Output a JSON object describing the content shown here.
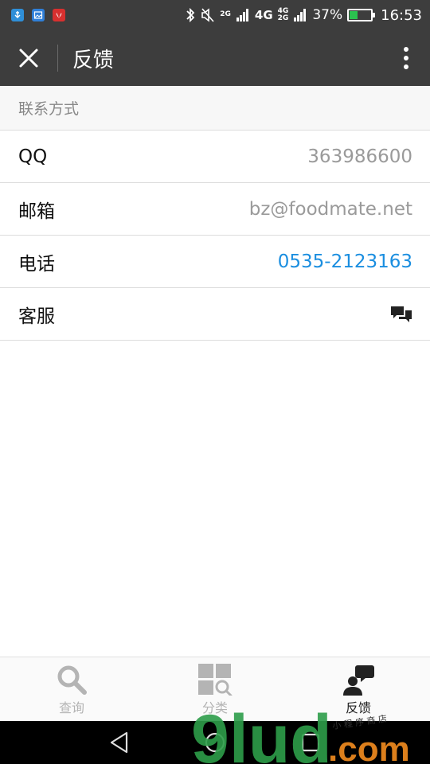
{
  "status_bar": {
    "net_2g": "2G",
    "net_4g": "4G",
    "net_4g_small": "4G",
    "net_2g_small": "2G",
    "battery_pct": "37%",
    "battery_level": 0.37,
    "time": "16:53"
  },
  "header": {
    "title": "反馈"
  },
  "section": {
    "title": "联系方式"
  },
  "rows": [
    {
      "label": "QQ",
      "value": "363986600"
    },
    {
      "label": "邮箱",
      "value": "bz@foodmate.net"
    },
    {
      "label": "电话",
      "value": "0535-2123163"
    },
    {
      "label": "客服"
    }
  ],
  "tabs": [
    {
      "label": "查询",
      "icon": "search-icon"
    },
    {
      "label": "分类",
      "icon": "category-icon"
    },
    {
      "label": "反馈",
      "icon": "feedback-icon",
      "active": true
    }
  ],
  "watermark": {
    "text": "9lud",
    "domain": ".com",
    "tagline": "小 程 序 商 店"
  },
  "colors": {
    "bar_bg": "#3d3d3d",
    "link": "#1a8ee0",
    "battery": "#2bc24f",
    "watermark_green": "#2e9e4a",
    "watermark_orange": "#e8861e"
  }
}
